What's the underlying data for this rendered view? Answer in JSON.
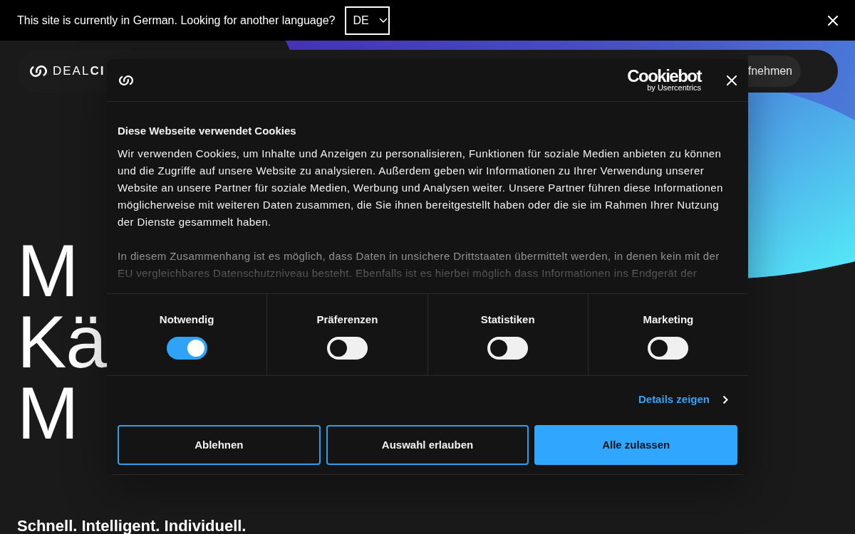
{
  "language_banner": {
    "message": "This site is currently in German. Looking for another language?",
    "language": "DE"
  },
  "site": {
    "logo": "DEAL**CI**",
    "nav_button": "fnehmen",
    "headline_lines": [
      "M",
      "Kä",
      "M"
    ],
    "tagline": "Schnell. Intelligent. Individuell."
  },
  "cookie_dialog": {
    "brand": {
      "name": "Cookiebot",
      "byline": "by Usercentrics"
    },
    "title": "Diese Webseite verwendet Cookies",
    "paragraphs": [
      "Wir verwenden Cookies, um Inhalte und Anzeigen zu personalisieren, Funktionen für soziale Medien anbieten zu können und die Zugriffe auf unsere Website zu analysieren. Außerdem geben wir Informationen zu Ihrer Verwendung unserer Website an unsere Partner für soziale Medien, Werbung und Analysen weiter. Unsere Partner führen diese Informationen möglicherweise mit weiteren Daten zusammen, die Sie ihnen bereitgestellt haben oder die sie im Rahmen Ihrer Nutzung der Dienste gesammelt haben.",
      "In diesem Zusammenhang ist es möglich, dass Daten in unsichere Drittstaaten übermittelt werden, in denen kein mit der EU vergleichbares Datenschutzniveau besteht. Ebenfalls ist es hierbei möglich dass Informationen ins Endgerät der"
    ],
    "categories": [
      {
        "label": "Notwendig",
        "on": true
      },
      {
        "label": "Präferenzen",
        "on": false
      },
      {
        "label": "Statistiken",
        "on": false
      },
      {
        "label": "Marketing",
        "on": false
      }
    ],
    "details_link": "Details zeigen",
    "buttons": [
      {
        "label": "Ablehnen",
        "kind": "outline"
      },
      {
        "label": "Auswahl erlauben",
        "kind": "outline"
      },
      {
        "label": "Alle zulassen",
        "kind": "primary"
      }
    ]
  }
}
